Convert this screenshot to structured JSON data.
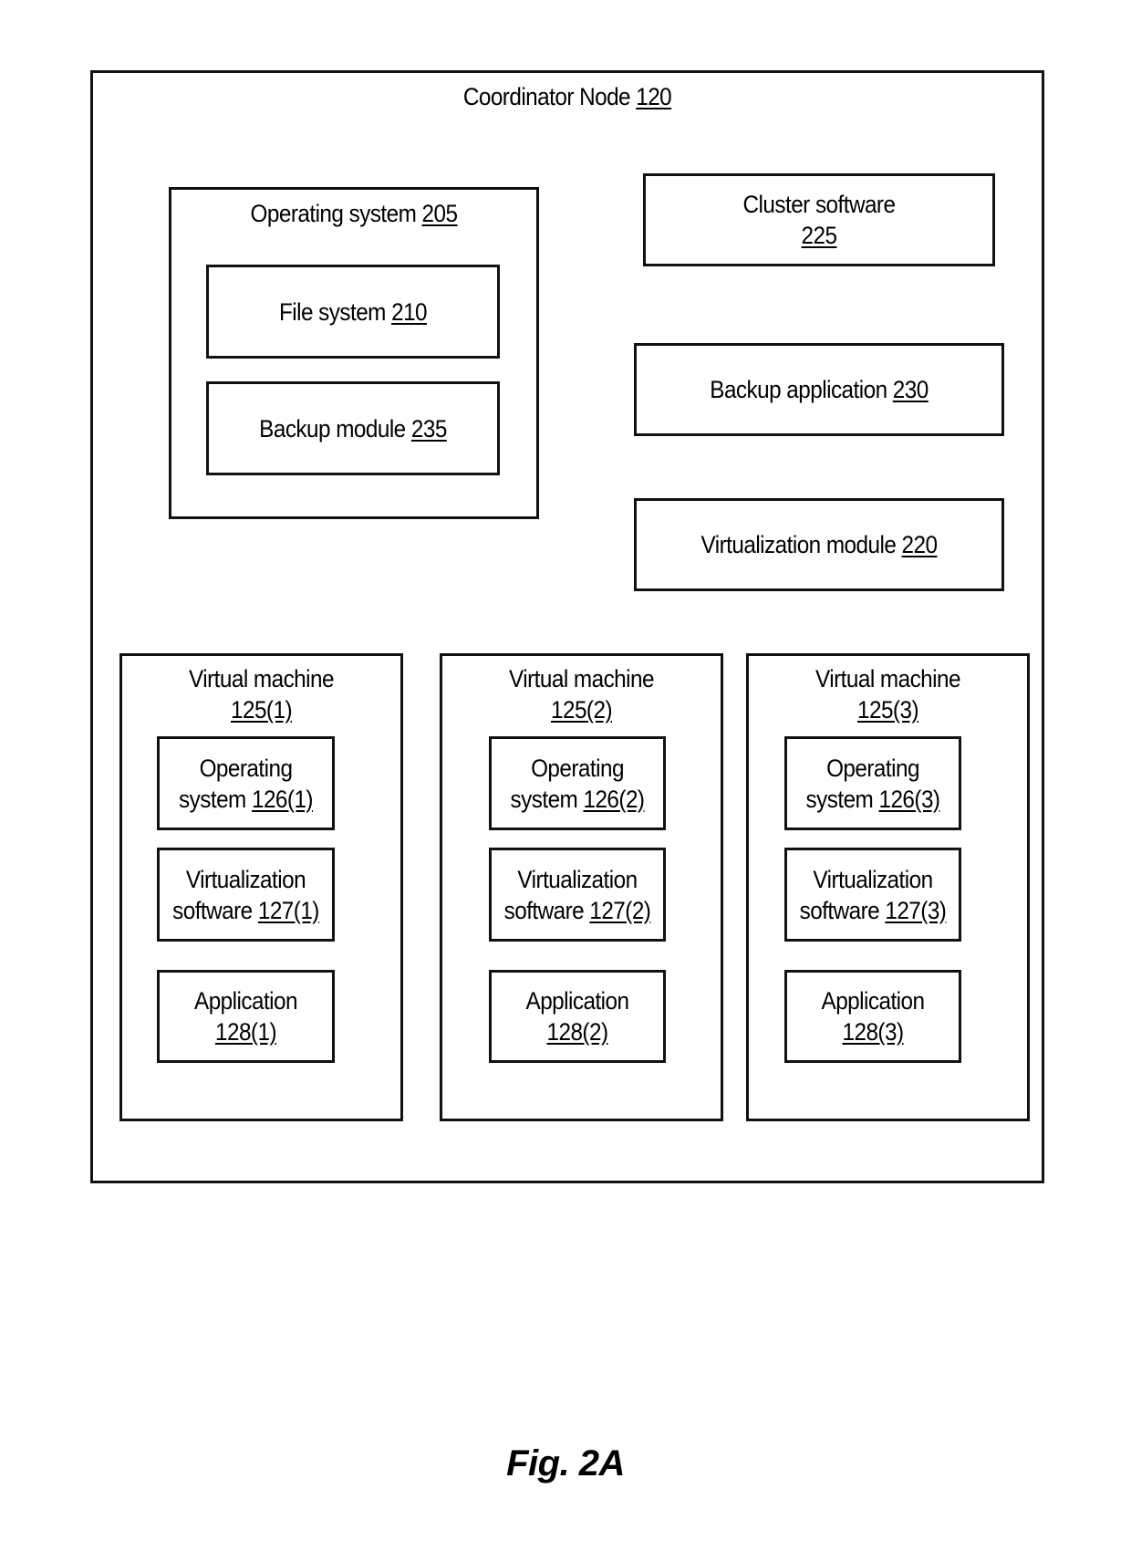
{
  "figure_label": "Fig. 2A",
  "coordinator": {
    "title": "Coordinator Node",
    "ref": "120"
  },
  "os": {
    "title": "Operating system",
    "ref": "205",
    "children": [
      {
        "title": "File system",
        "ref": "210"
      },
      {
        "title": "Backup module",
        "ref": "235"
      }
    ]
  },
  "cluster_software": {
    "title": "Cluster software",
    "ref": "225"
  },
  "backup_application": {
    "title": "Backup application",
    "ref": "230"
  },
  "virtualization_module": {
    "title": "Virtualization module",
    "ref": "220"
  },
  "vms": [
    {
      "title": "Virtual machine",
      "ref": "125(1)",
      "os": {
        "line1": "Operating",
        "line2": "system",
        "ref": "126(1)"
      },
      "virt": {
        "line1": "Virtualization",
        "line2": "software",
        "ref": "127(1)"
      },
      "app": {
        "line1": "Application",
        "ref": "128(1)"
      }
    },
    {
      "title": "Virtual machine",
      "ref": "125(2)",
      "os": {
        "line1": "Operating",
        "line2": "system",
        "ref": "126(2)"
      },
      "virt": {
        "line1": "Virtualization",
        "line2": "software",
        "ref": "127(2)"
      },
      "app": {
        "line1": "Application",
        "ref": "128(2)"
      }
    },
    {
      "title": "Virtual machine",
      "ref": "125(3)",
      "os": {
        "line1": "Operating",
        "line2": "system",
        "ref": "126(3)"
      },
      "virt": {
        "line1": "Virtualization",
        "line2": "software",
        "ref": "127(3)"
      },
      "app": {
        "line1": "Application",
        "ref": "128(3)"
      }
    }
  ]
}
